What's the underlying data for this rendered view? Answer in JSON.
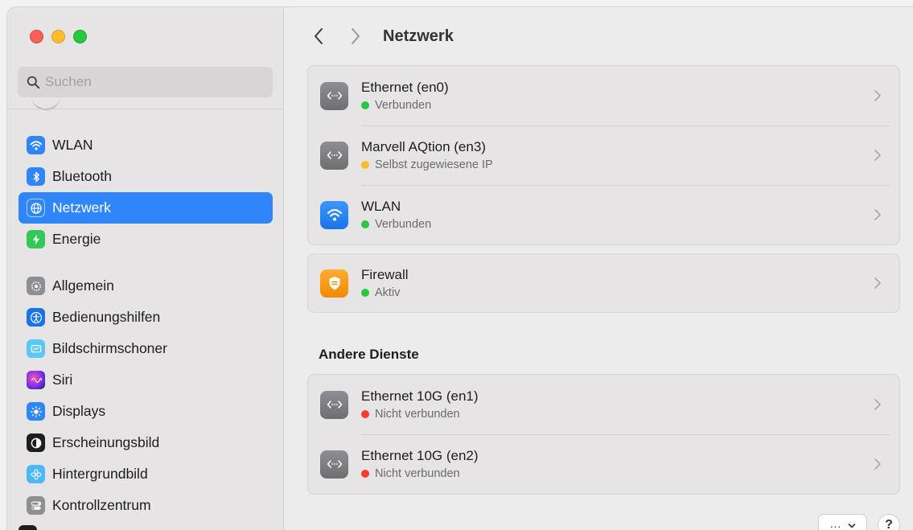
{
  "window": {
    "traffic_lights": [
      "close",
      "minimize",
      "zoom"
    ]
  },
  "sidebar": {
    "search_placeholder": "Suchen",
    "items": [
      {
        "label": "WLAN",
        "icon": "wifi-icon",
        "color": "#2f86f8"
      },
      {
        "label": "Bluetooth",
        "icon": "bluetooth-icon",
        "color": "#2f86f8"
      },
      {
        "label": "Netzwerk",
        "icon": "globe-icon",
        "color": "#2f86f8",
        "active": true
      },
      {
        "label": "Energie",
        "icon": "bolt-icon",
        "color": "#34c759"
      },
      {
        "label": "Allgemein",
        "icon": "gear-icon",
        "color": "#8e8e93"
      },
      {
        "label": "Bedienungshilfen",
        "icon": "accessibility-icon",
        "color": "#1a73e8"
      },
      {
        "label": "Bildschirmschoner",
        "icon": "screensaver-icon",
        "color": "#5ac8fa"
      },
      {
        "label": "Siri",
        "icon": "siri-icon",
        "color": "#7b2ff7"
      },
      {
        "label": "Displays",
        "icon": "sun-icon",
        "color": "#2f86f8"
      },
      {
        "label": "Erscheinungsbild",
        "icon": "appearance-icon",
        "color": "#1e1e1e"
      },
      {
        "label": "Hintergrundbild",
        "icon": "flower-icon",
        "color": "#4cb8f5"
      },
      {
        "label": "Kontrollzentrum",
        "icon": "toggles-icon",
        "color": "#8e8e93"
      }
    ]
  },
  "header": {
    "title": "Netzwerk"
  },
  "services": [
    {
      "name": "Ethernet (en0)",
      "status": "Verbunden",
      "status_color": "#28c840",
      "icon": "ethernet-icon"
    },
    {
      "name": "Marvell AQtion (en3)",
      "status": "Selbst zugewiesene IP",
      "status_color": "#febc2e",
      "icon": "ethernet-icon"
    },
    {
      "name": "WLAN",
      "status": "Verbunden",
      "status_color": "#28c840",
      "icon": "wifi-icon"
    }
  ],
  "firewall": {
    "name": "Firewall",
    "status": "Aktiv",
    "status_color": "#28c840",
    "icon": "firewall-icon"
  },
  "other_services": {
    "title": "Andere Dienste",
    "items": [
      {
        "name": "Ethernet 10G (en1)",
        "status": "Nicht verbunden",
        "status_color": "#ff3b30",
        "icon": "ethernet-icon"
      },
      {
        "name": "Ethernet 10G (en2)",
        "status": "Nicht verbunden",
        "status_color": "#ff3b30",
        "icon": "ethernet-icon"
      }
    ]
  },
  "footer": {
    "more_label": "···",
    "help_label": "?"
  }
}
